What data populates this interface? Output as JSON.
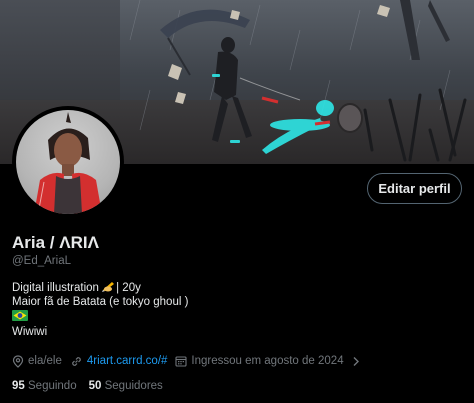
{
  "profile": {
    "display_name": "Aria / ΛRIΛ",
    "handle": "@Ed_AriaL",
    "edit_button_label": "Editar perfil",
    "bio": {
      "line1_pre": "Digital illustration ",
      "line1_post": "| 20y",
      "line2": "Maior fã de Batata (e tokyo ghoul )",
      "line4": "Wiwiwi"
    },
    "meta": {
      "pronouns": "ela/ele",
      "website": "4riart.carrd.co/#",
      "joined": "Ingressou em agosto de 2024"
    },
    "stats": {
      "following_count": "95",
      "following_label": "Seguindo",
      "followers_count": "50",
      "followers_label": "Seguidores"
    }
  },
  "icons": [
    "location-icon",
    "link-icon",
    "calendar-icon",
    "chevron-right-icon",
    "writing-hand-emoji",
    "brazil-flag-emoji"
  ],
  "colors": {
    "background": "#000000",
    "text_primary": "#e7e9ea",
    "text_secondary": "#71767b",
    "link": "#1d9bf0",
    "button_border": "#536471",
    "banner_accent": "#2ee6e6"
  }
}
